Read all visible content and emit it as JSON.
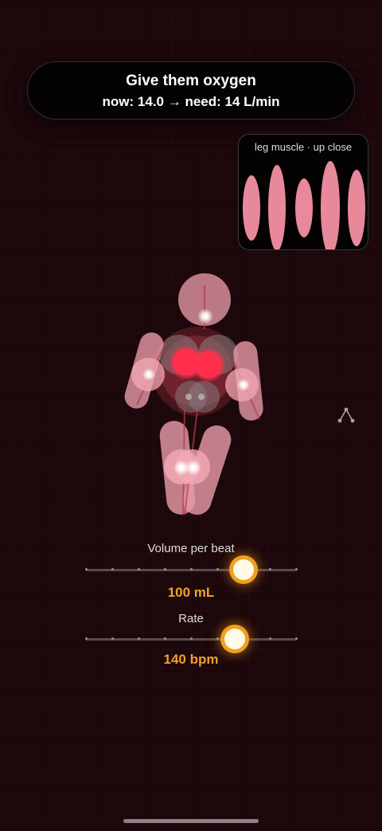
{
  "goal": {
    "title": "Give them oxygen",
    "status": "now: 14.0 → need: 14 L/min"
  },
  "inset": {
    "label": "leg muscle · up close",
    "fiber_count": 5,
    "fiber_color": "#e8899b"
  },
  "figure": {
    "body_color": "#e79aa7",
    "heart_color": "#ff2f4c"
  },
  "controls": {
    "volume": {
      "label": "Volume per beat",
      "value_text": "100 mL",
      "level": 0.75
    },
    "rate": {
      "label": "Rate",
      "value_text": "140 bpm",
      "level": 0.71
    }
  },
  "colors": {
    "background": "#1c070b",
    "accent": "#f2a12a"
  },
  "icons": {
    "side": "graph-nodes-icon"
  }
}
